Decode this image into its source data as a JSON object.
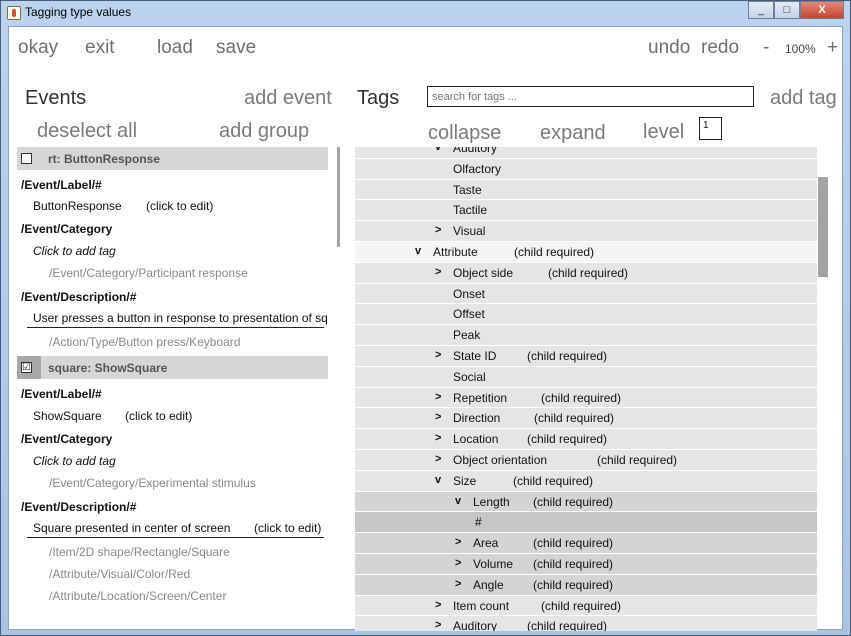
{
  "window": {
    "title": "Tagging type values",
    "buttons": [
      "_",
      "□",
      "X"
    ]
  },
  "toolbar": {
    "okay": "okay",
    "exit": "exit",
    "load": "load",
    "save": "save",
    "undo": "undo",
    "redo": "redo",
    "minus": "-",
    "zoom": "100%",
    "plus": "+"
  },
  "events_panel": {
    "title": "Events",
    "add_event": "add event",
    "deselect_all": "deselect all",
    "add_group": "add group",
    "events": [
      {
        "checked": false,
        "header": "rt: ButtonResponse",
        "lines": [
          {
            "text": "/Event/Label/#",
            "style": "b"
          },
          {
            "text": "ButtonResponse",
            "edit": "(click to edit)"
          },
          {
            "text": "/Event/Category",
            "style": "b"
          },
          {
            "text": "Click to add tag",
            "style": "i"
          },
          {
            "text": "/Event/Category/Participant response",
            "style": "g"
          },
          {
            "text": "/Event/Description/#",
            "style": "b"
          },
          {
            "text": "User presses a button in response to presentation of sq"
          },
          {
            "text": "/Action/Type/Button press/Keyboard",
            "style": "g"
          }
        ]
      },
      {
        "checked": true,
        "check_mark": "☑",
        "header": "square: ShowSquare",
        "lines": [
          {
            "text": "/Event/Label/#",
            "style": "b"
          },
          {
            "text": "ShowSquare",
            "edit": "(click to edit)"
          },
          {
            "text": "/Event/Category",
            "style": "b"
          },
          {
            "text": "Click to add tag",
            "style": "i"
          },
          {
            "text": "/Event/Category/Experimental stimulus",
            "style": "g"
          },
          {
            "text": "/Event/Description/#",
            "style": "b"
          },
          {
            "text": "Square presented in center of screen",
            "edit": "(click to edit)"
          },
          {
            "text": "/Item/2D shape/Rectangle/Square",
            "style": "g"
          },
          {
            "text": "/Attribute/Visual/Color/Red",
            "style": "g"
          },
          {
            "text": "/Attribute/Location/Screen/Center",
            "style": "g"
          }
        ]
      }
    ]
  },
  "tags_panel": {
    "title": "Tags",
    "search_placeholder": "search for tags ...",
    "add_tag": "add tag",
    "collapse": "collapse",
    "expand": "expand",
    "level_label": "level",
    "level_value": "1",
    "rows": [
      {
        "name": "Auditory",
        "depth": 1,
        "chev": "v"
      },
      {
        "name": "Olfactory",
        "depth": 1
      },
      {
        "name": "Taste",
        "depth": 1
      },
      {
        "name": "Tactile",
        "depth": 1
      },
      {
        "name": "Visual",
        "depth": 1,
        "chev": ">"
      },
      {
        "name": "Attribute",
        "depth": 0,
        "chev": "v",
        "note": "(child required)"
      },
      {
        "name": "Object side",
        "depth": 1,
        "chev": ">",
        "note": "(child required)"
      },
      {
        "name": "Onset",
        "depth": 1
      },
      {
        "name": "Offset",
        "depth": 1
      },
      {
        "name": "Peak",
        "depth": 1
      },
      {
        "name": "State ID",
        "depth": 1,
        "chev": ">",
        "note": "(child required)"
      },
      {
        "name": "Social",
        "depth": 1
      },
      {
        "name": "Repetition",
        "depth": 1,
        "chev": ">",
        "note": "(child required)"
      },
      {
        "name": "Direction",
        "depth": 1,
        "chev": ">",
        "note": "(child required)"
      },
      {
        "name": "Location",
        "depth": 1,
        "chev": ">",
        "note": "(child required)"
      },
      {
        "name": "Object orientation",
        "depth": 1,
        "chev": ">",
        "note": "(child required)"
      },
      {
        "name": "Size",
        "depth": 1,
        "chev": "v",
        "note": "(child required)"
      },
      {
        "name": "Length",
        "depth": 2,
        "chev": "v",
        "note": "(child required)"
      },
      {
        "name": "#",
        "depth": 3
      },
      {
        "name": "Area",
        "depth": 2,
        "chev": ">",
        "note": "(child required)"
      },
      {
        "name": "Volume",
        "depth": 2,
        "chev": ">",
        "note": "(child required)"
      },
      {
        "name": "Angle",
        "depth": 2,
        "chev": ">",
        "note": "(child required)"
      },
      {
        "name": "Item count",
        "depth": 1,
        "chev": ">",
        "note": "(child required)"
      },
      {
        "name": "Auditory",
        "depth": 1,
        "chev": ">",
        "note": "(child required)"
      }
    ]
  }
}
